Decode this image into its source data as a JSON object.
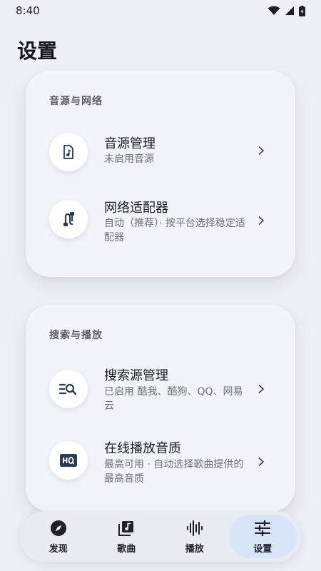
{
  "status_bar": {
    "time": "8:40"
  },
  "page": {
    "title": "设置"
  },
  "sections": [
    {
      "header": "音源与网络",
      "items": [
        {
          "icon": "music-file-icon",
          "title": "音源管理",
          "subtitle": "未启用音源"
        },
        {
          "icon": "cable-icon",
          "title": "网络适配器",
          "subtitle": "自动（推荐）· 按平台选择稳定适配器"
        }
      ]
    },
    {
      "header": "搜索与播放",
      "items": [
        {
          "icon": "search-list-icon",
          "title": "搜索源管理",
          "subtitle": "已启用 酷我、酷狗、QQ、网易云"
        },
        {
          "icon": "hq-icon",
          "title": "在线播放音质",
          "subtitle": "最高可用 · 自动选择歌曲提供的最高音质"
        }
      ]
    }
  ],
  "nav": {
    "items": [
      {
        "icon": "compass-icon",
        "label": "发现"
      },
      {
        "icon": "music-library-icon",
        "label": "歌曲"
      },
      {
        "icon": "waveform-icon",
        "label": "播放"
      },
      {
        "icon": "sliders-icon",
        "label": "设置"
      }
    ],
    "active": "设置"
  }
}
